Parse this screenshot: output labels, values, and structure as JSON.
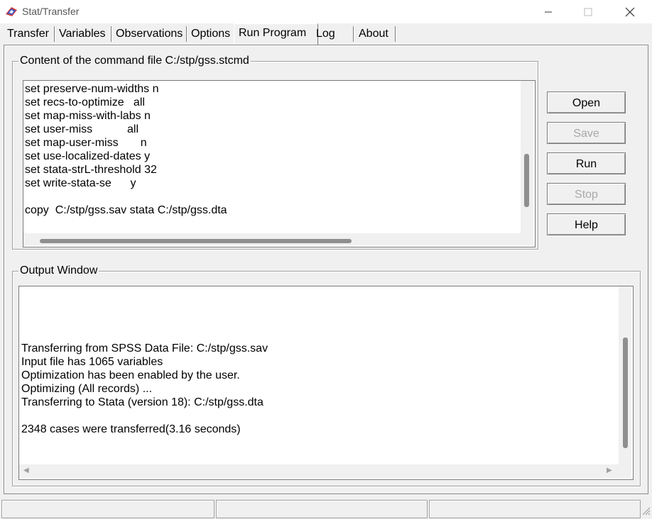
{
  "window": {
    "title": "Stat/Transfer",
    "controls": {
      "minimize": "—",
      "maximize": "☐",
      "close": "✕"
    }
  },
  "tabs": [
    {
      "label": "Transfer"
    },
    {
      "label": "Variables"
    },
    {
      "label": "Observations"
    },
    {
      "label": "Options"
    },
    {
      "label": "Run Program",
      "active": true
    },
    {
      "label": "Log"
    },
    {
      "label": "About"
    }
  ],
  "command_panel": {
    "title": "Content of the command file C:/stp/gss.stcmd",
    "lines": [
      "set preserve-num-widths n",
      "set recs-to-optimize   all",
      "set map-miss-with-labs n",
      "set user-miss           all",
      "set map-user-miss       n",
      "set use-localized-dates y",
      "set stata-strL-threshold 32",
      "set write-stata-se      y",
      "",
      "copy  C:/stp/gss.sav stata C:/stp/gss.dta"
    ]
  },
  "buttons": {
    "open": "Open",
    "save": "Save",
    "run": "Run",
    "stop": "Stop",
    "help": "Help"
  },
  "output_panel": {
    "title": "Output Window",
    "lines": [
      "Transferring from SPSS Data File: C:/stp/gss.sav",
      "Input file has 1065 variables",
      "Optimization has been enabled by the user.",
      "Optimizing (All records) ...",
      "Transferring to Stata (version 18): C:/stp/gss.dta",
      "",
      "2348 cases were transferred(3.16 seconds)"
    ]
  },
  "colors": {
    "background": "#f0f0f0",
    "disabled_text": "#a8a8a8",
    "scroll_thumb": "#8f8f8f"
  }
}
